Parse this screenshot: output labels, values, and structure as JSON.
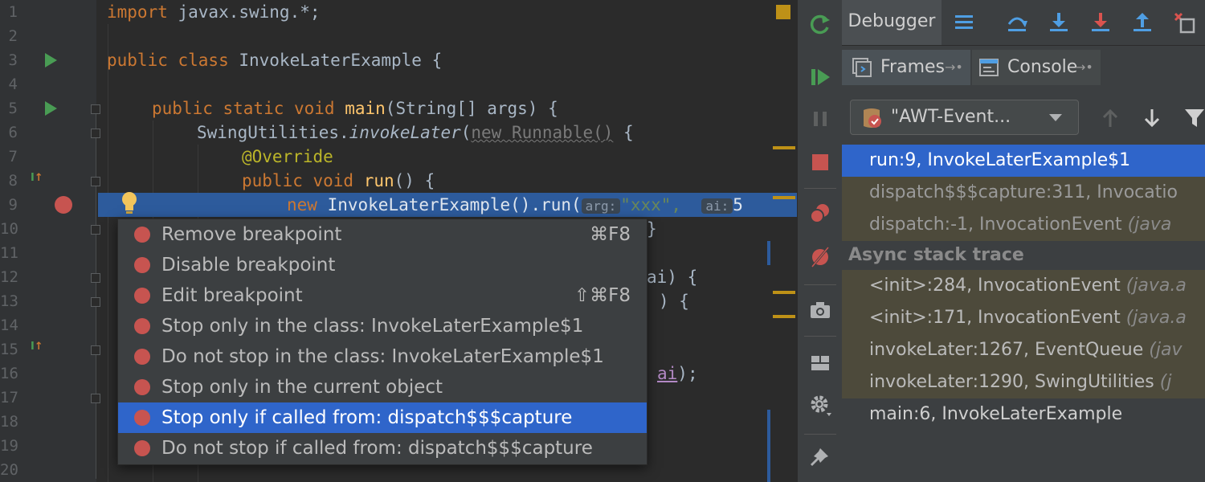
{
  "editor": {
    "line_numbers": [
      "1",
      "2",
      "3",
      "4",
      "5",
      "6",
      "7",
      "8",
      "9",
      "10",
      "11",
      "12",
      "13",
      "14",
      "15",
      "16",
      "17",
      "18",
      "19",
      "20"
    ],
    "lines": {
      "l1": {
        "kw": "import",
        "rest": " javax.swing.*;"
      },
      "l3": {
        "kw": "public class",
        "rest": " InvokeLaterExample {"
      },
      "l5": {
        "kw": "public static void",
        "fn": " main",
        "rest": "(String[] args) {"
      },
      "l6": {
        "pre": "SwingUtilities.",
        "it": "invokeLater",
        "open": "(",
        "dim": "new Runnable()",
        "rest": " {"
      },
      "l7": {
        "ann": "@Override"
      },
      "l8": {
        "kw": "public void",
        "fn": " run",
        "rest": "() {"
      },
      "l9": {
        "kw": "new",
        "rest": " InvokeLaterExample().run(",
        "hint1": "arg:",
        "str": "\"xxx\",",
        "hint2": "ai:",
        "tail": "5"
      },
      "l10": {
        "rest": "}"
      },
      "l12": {
        "rest": "ai) {"
      },
      "l13": {
        "rest": ") {"
      },
      "l16": {
        "u": "ai",
        "rest": ");"
      }
    }
  },
  "context_menu": {
    "items": [
      {
        "label": "Remove breakpoint",
        "shortcut": "⌘F8"
      },
      {
        "label": "Disable breakpoint",
        "shortcut": ""
      },
      {
        "label": "Edit breakpoint",
        "shortcut": "⇧⌘F8"
      },
      {
        "label": "Stop only in the class: InvokeLaterExample$1",
        "shortcut": ""
      },
      {
        "label": "Do not stop in the class: InvokeLaterExample$1",
        "shortcut": ""
      },
      {
        "label": "Stop only in the current object",
        "shortcut": ""
      },
      {
        "label": "Stop only if called from: dispatch$$$capture",
        "shortcut": ""
      },
      {
        "label": "Do not stop if called from: dispatch$$$capture",
        "shortcut": ""
      }
    ],
    "selected_index": 6
  },
  "debugger": {
    "title": "Debugger",
    "tabs": [
      {
        "label": "Frames",
        "pin": "→•"
      },
      {
        "label": "Console",
        "pin": "→•"
      }
    ],
    "thread": "\"AWT-Event...",
    "frames": [
      {
        "text": "run:9, InvokeLaterExample$1",
        "pkg": ""
      },
      {
        "text": "dispatch$$$capture:311, Invocatio",
        "pkg": ""
      },
      {
        "text": "dispatch:-1, InvocationEvent ",
        "pkg": "(java"
      }
    ],
    "async_header": "Async stack trace",
    "async_frames": [
      {
        "text": "<init>:284, InvocationEvent ",
        "pkg": "(java.a"
      },
      {
        "text": "<init>:171, InvocationEvent ",
        "pkg": "(java.a"
      },
      {
        "text": "invokeLater:1267, EventQueue ",
        "pkg": "(jav"
      },
      {
        "text": "invokeLater:1290, SwingUtilities ",
        "pkg": "(j"
      },
      {
        "text": "main:6, InvokeLaterExample",
        "pkg": ""
      }
    ]
  },
  "colors": {
    "accent_selection": "#2f65ca",
    "breakpoint": "#c75450",
    "run_green": "#499c54",
    "execution_line": "#2d5b9c"
  },
  "icons": {
    "strip": [
      "rerun-icon",
      "resume-icon",
      "pause-icon",
      "stop-icon",
      "view-breakpoints-icon",
      "mute-breakpoints-icon",
      "snapshot-icon",
      "layout-icon",
      "settings-icon",
      "pin-icon"
    ],
    "toolbar": [
      "show-execution-point-icon",
      "step-over-icon",
      "step-into-icon",
      "force-step-into-icon",
      "step-out-icon",
      "drop-frame-icon"
    ]
  }
}
